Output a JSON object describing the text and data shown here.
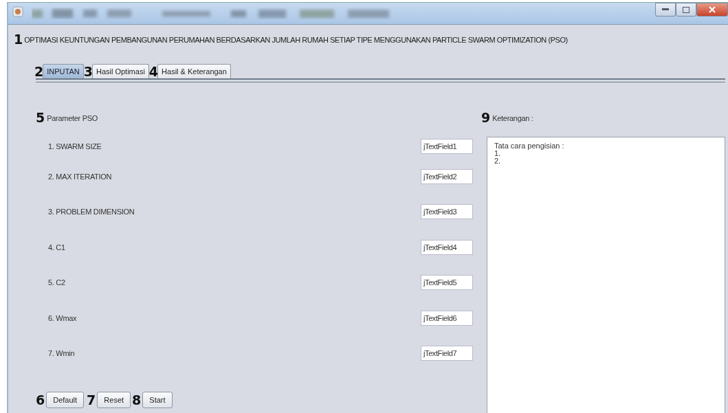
{
  "heading": {
    "marker": "1",
    "text": "OPTIMASI KEUNTUNGAN PEMBANGUNAN PERUMAHAN BERDASARKAN JUMLAH RUMAH SETIAP TIPE MENGGUNAKAN PARTICLE SWARM OPTIMIZATION (PSO)"
  },
  "tabs": [
    {
      "marker": "2",
      "label": "INPUTAN",
      "selected": true
    },
    {
      "marker": "3",
      "label": "Hasil Optimasi",
      "selected": false
    },
    {
      "marker": "4",
      "label": "Hasil & Keterangan",
      "selected": false
    }
  ],
  "parameters": {
    "marker": "5",
    "title": "Parameter PSO",
    "rows": [
      {
        "label": "1. SWARM SIZE",
        "value": "jTextField1"
      },
      {
        "label": "2. MAX ITERATION",
        "value": "jTextField2"
      },
      {
        "label": "3. PROBLEM DIMENSION",
        "value": "jTextField3"
      },
      {
        "label": "4. C1",
        "value": "jTextField4"
      },
      {
        "label": "5. C2",
        "value": "jTextField5"
      },
      {
        "label": "6. Wmax",
        "value": "jTextField6"
      },
      {
        "label": "7. Wmin",
        "value": "jTextField7"
      }
    ]
  },
  "buttons": [
    {
      "marker": "6",
      "label": "Default"
    },
    {
      "marker": "7",
      "label": "Reset"
    },
    {
      "marker": "8",
      "label": "Start"
    }
  ],
  "notes": {
    "marker": "9",
    "title": "Keterangan :",
    "lines": [
      "Tata cara pengisian :",
      "1.",
      "2."
    ]
  }
}
